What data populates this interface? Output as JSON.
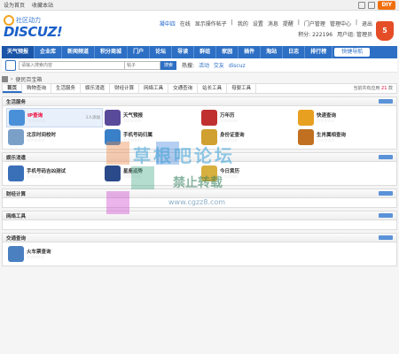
{
  "topbar": {
    "links": [
      "设为首页",
      "收藏本站"
    ],
    "diy": "DIY"
  },
  "logo": {
    "sub": "社区动力",
    "main": "DISCUZ!"
  },
  "user": {
    "name": "凝中四",
    "online": "在线",
    "links1": [
      "显示操作帖子",
      "|",
      "我的",
      "设置",
      "消息",
      "提醒",
      "|",
      "门户管理",
      "管理中心",
      "|",
      "退出"
    ],
    "points": "积分: 222196",
    "group": "用户组: 管理员"
  },
  "nav": {
    "items": [
      "天气预报",
      "企业库",
      "新闻频道",
      "积分商城",
      "门户",
      "论坛",
      "导读",
      "群组",
      "家园",
      "插件",
      "淘站",
      "日志",
      "排行榜"
    ],
    "active_index": 0,
    "quick": "快捷导航"
  },
  "search": {
    "placeholder": "请输入搜索内容",
    "type": "帖子",
    "button": "搜索",
    "hot_label": "热搜:",
    "hot": [
      "活动",
      "交友",
      "discuz"
    ]
  },
  "crumb": {
    "label": "便民百宝箱"
  },
  "tabs": {
    "items": [
      "首页",
      "购物查询",
      "生活服务",
      "娱乐消遣",
      "财经计算",
      "网络工具",
      "交通查询",
      "站长工具",
      "母婴工具"
    ],
    "active_index": 0,
    "count_prefix": "当前共有应用",
    "count": "21",
    "count_suffix": "款"
  },
  "sections": [
    {
      "title": "生活服务",
      "apps": [
        {
          "name": "IP查询",
          "users": "1人添加",
          "color": "#4a90d9",
          "name_color": "red"
        },
        {
          "name": "天气预报",
          "color": "#5a4a9a"
        },
        {
          "name": "万年历",
          "color": "#c03030"
        },
        {
          "name": "快递查询",
          "color": "#e8a020"
        },
        {
          "name": "北京时间校时",
          "color": "#7aa0c8"
        },
        {
          "name": "手机号码归属",
          "color": "#3a80c8"
        },
        {
          "name": "身份证查询",
          "color": "#d0a030"
        },
        {
          "name": "生肖属相查询",
          "color": "#c07020"
        }
      ]
    },
    {
      "title": "娱乐消遣",
      "apps": [
        {
          "name": "手机号码吉凶测试",
          "color": "#3a70b8"
        },
        {
          "name": "星座运势",
          "color": "#2a4a8a"
        },
        {
          "name": "今日黄历",
          "color": "#d8b040"
        }
      ]
    },
    {
      "title": "财经计算",
      "apps": []
    },
    {
      "title": "网络工具",
      "apps": []
    },
    {
      "title": "交通查询",
      "apps": [
        {
          "name": "火车票查询",
          "color": "#4a80c0"
        }
      ]
    }
  ],
  "stars": "☆☆☆☆☆",
  "watermark": {
    "line1": "草根吧论坛",
    "line2": "禁止转载",
    "line3": "www.cgzz8.com"
  }
}
